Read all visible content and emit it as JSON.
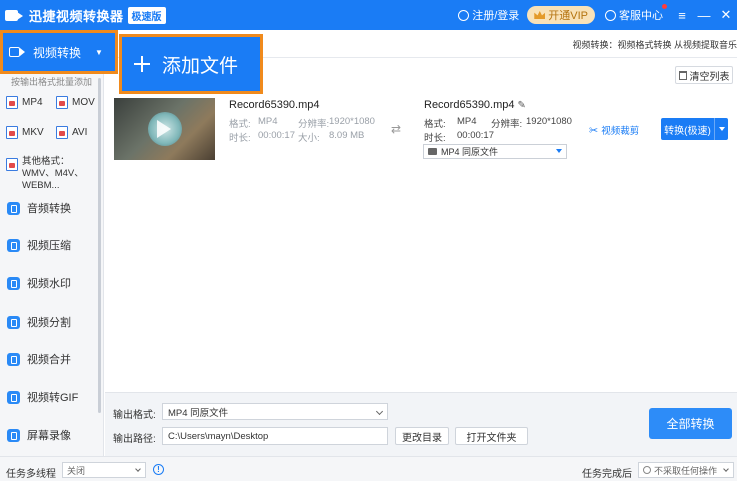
{
  "titlebar": {
    "app_title": "迅捷视频转换器",
    "badge": "极速版",
    "login": "注册/登录",
    "vip": "开通VIP",
    "service": "客服中心",
    "menu_glyph": "≡",
    "min_glyph": "—",
    "close_glyph": "✕"
  },
  "sidebar": {
    "active": {
      "label": "视频转换"
    },
    "subtitle": "按输出格式批量添加",
    "formats": [
      "MP4",
      "MOV",
      "MKV",
      "AVI"
    ],
    "other_formats": "其他格式：WMV、M4V、WEBM...",
    "items": [
      {
        "label": "音频转换"
      },
      {
        "label": "视频压缩"
      },
      {
        "label": "视频水印"
      },
      {
        "label": "视频分割"
      },
      {
        "label": "视频合并"
      },
      {
        "label": "视频转GIF"
      },
      {
        "label": "屏幕录像"
      }
    ]
  },
  "main": {
    "head_tip": "视频转换：视频格式转换 从视频提取音乐",
    "add_file": "添加文件",
    "clear_list": "清空列表",
    "file": {
      "source": {
        "name": "Record65390.mp4",
        "format_label": "格式:",
        "format": "MP4",
        "resolution_label": "分辨率:",
        "resolution": "1920*1080",
        "duration_label": "时长:",
        "duration": "00:00:17",
        "size_label": "大小:",
        "size": "8.09 MB"
      },
      "output": {
        "name": "Record65390.mp4",
        "format_label": "格式:",
        "format": "MP4",
        "resolution_label": "分辨率:",
        "resolution": "1920*1080",
        "duration_label": "时长:",
        "duration": "00:00:17",
        "select_value": "MP4   同原文件"
      },
      "edit_link": "视频裁剪",
      "convert_button": "转换(极速)"
    }
  },
  "bottom": {
    "output_format_label": "输出格式:",
    "output_format_value": "MP4   同原文件",
    "output_path_label": "输出路径:",
    "output_path_value": "C:\\Users\\mayn\\Desktop",
    "change_dir": "更改目录",
    "open_folder": "打开文件夹",
    "convert_all": "全部转换"
  },
  "status": {
    "multithread_label": "任务多线程",
    "multithread_value": "关闭",
    "after_done_label": "任务完成后",
    "after_done_value": "不采取任何操作"
  }
}
